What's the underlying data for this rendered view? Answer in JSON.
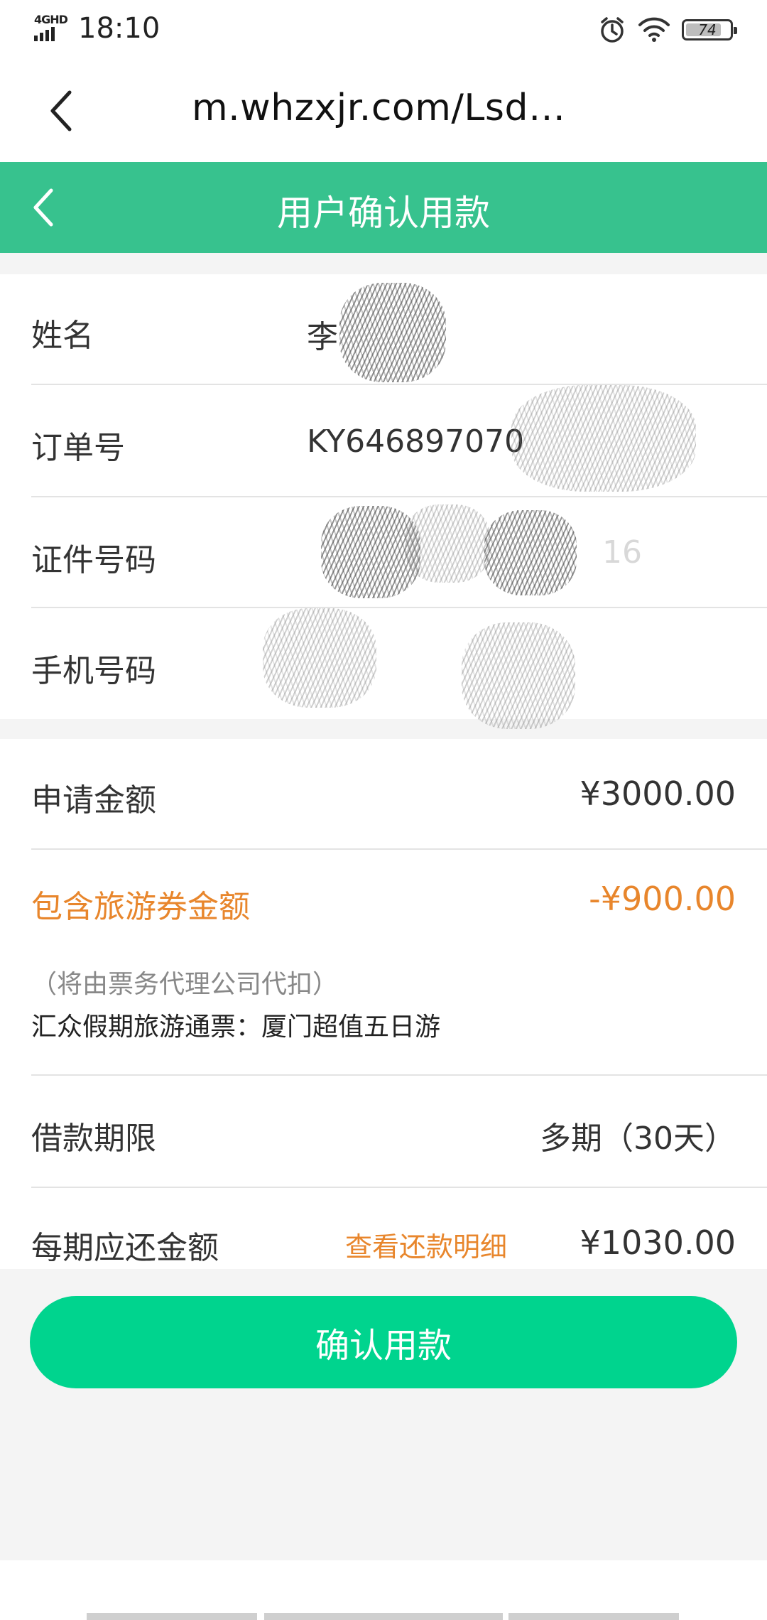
{
  "status_bar": {
    "network": "4GHD",
    "time": "18:10",
    "battery": "74",
    "battery_level_percent": 74
  },
  "browser": {
    "url": "m.whzxjr.com/Lsd…"
  },
  "header": {
    "title": "用户确认用款"
  },
  "user_info": {
    "name_label": "姓名",
    "name_value": "李",
    "order_label": "订单号",
    "order_value": "KY646897070",
    "id_label": "证件号码",
    "id_value": "16",
    "phone_label": "手机号码"
  },
  "loan": {
    "apply_label": "申请金额",
    "apply_amount": "¥3000.00",
    "voucher_label": "包含旅游券金额",
    "voucher_amount": "-¥900.00",
    "voucher_note": "（将由票务代理公司代扣）",
    "voucher_product": "汇众假期旅游通票：厦门超值五日游",
    "term_label": "借款期限",
    "term_value": "多期（30天）",
    "per_period_label": "每期应还金额",
    "details_link": "查看还款明细",
    "per_period_amount": "¥1030.00"
  },
  "actions": {
    "confirm_label": "确认用款"
  }
}
